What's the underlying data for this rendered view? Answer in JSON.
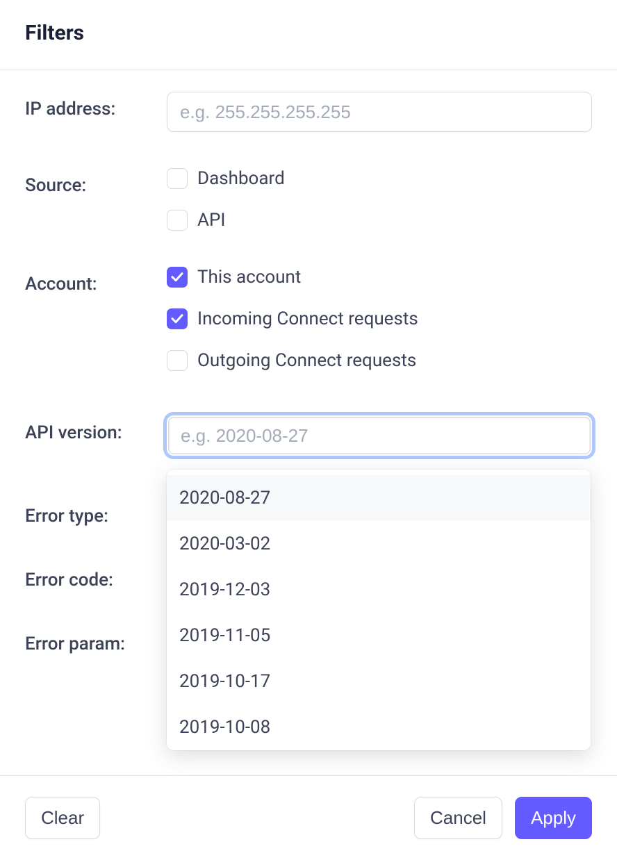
{
  "header": {
    "title": "Filters"
  },
  "ip_address": {
    "label": "IP address:",
    "placeholder": "e.g. 255.255.255.255",
    "value": ""
  },
  "source": {
    "label": "Source:",
    "options": [
      {
        "label": "Dashboard",
        "checked": false
      },
      {
        "label": "API",
        "checked": false
      }
    ]
  },
  "account": {
    "label": "Account:",
    "options": [
      {
        "label": "This account",
        "checked": true
      },
      {
        "label": "Incoming Connect requests",
        "checked": true
      },
      {
        "label": "Outgoing Connect requests",
        "checked": false
      }
    ]
  },
  "api_version": {
    "label": "API version:",
    "placeholder": "e.g. 2020-08-27",
    "value": "",
    "dropdown": [
      "2020-08-27",
      "2020-03-02",
      "2019-12-03",
      "2019-11-05",
      "2019-10-17",
      "2019-10-08"
    ]
  },
  "error_type": {
    "label": "Error type:"
  },
  "error_code": {
    "label": "Error code:"
  },
  "error_param": {
    "label": "Error param:"
  },
  "footer": {
    "clear": "Clear",
    "cancel": "Cancel",
    "apply": "Apply"
  }
}
